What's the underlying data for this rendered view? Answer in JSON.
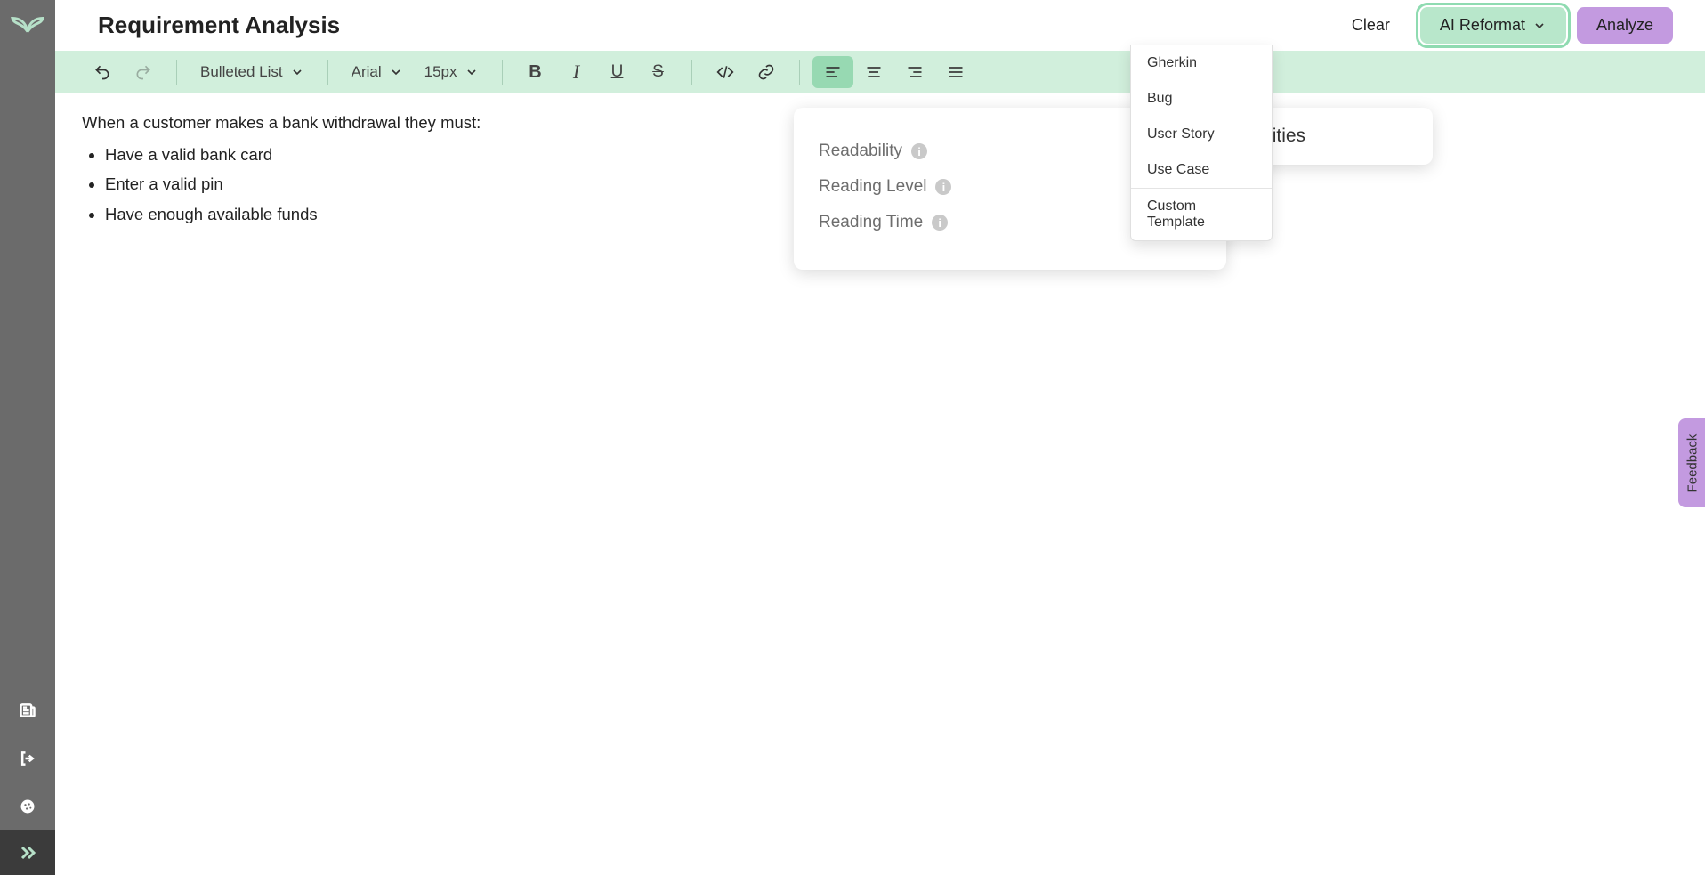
{
  "header": {
    "title": "Requirement Analysis",
    "clear_label": "Clear",
    "reformat_label": "AI Reformat",
    "analyze_label": "Analyze"
  },
  "dropdown": {
    "items": [
      "Gherkin",
      "Bug",
      "User Story",
      "Use Case"
    ],
    "footer": "Custom Template"
  },
  "toolbar": {
    "block_format": "Bulleted List",
    "font": "Arial",
    "size": "15px"
  },
  "editor": {
    "intro": "When a customer makes a bank withdrawal they must:",
    "bullets": [
      "Have a valid bank card",
      "Enter a valid pin",
      "Have enough available funds"
    ]
  },
  "metrics": {
    "items": [
      "Readability",
      "Reading Level",
      "Reading Time"
    ]
  },
  "right_panel": {
    "visible_text": "al Entities"
  },
  "feedback": {
    "label": "Feedback"
  },
  "colors": {
    "accent_green": "#b8e7cb",
    "accent_purple": "#c39ae0",
    "toolbar_bg": "#d1efdc"
  }
}
